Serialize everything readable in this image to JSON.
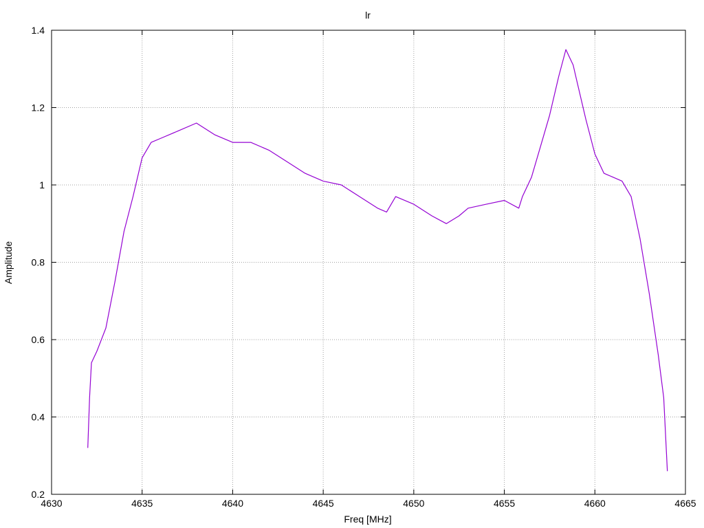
{
  "chart_data": {
    "type": "line",
    "title": "lr",
    "xlabel": "Freq [MHz]",
    "ylabel": "Amplitude",
    "xlim": [
      4630,
      4665
    ],
    "ylim": [
      0.2,
      1.4
    ],
    "grid": true,
    "xticks": [
      4630,
      4635,
      4640,
      4645,
      4650,
      4655,
      4660,
      4665
    ],
    "xtick_labels": [
      "4630",
      "4635",
      "4640",
      "4645",
      "4650",
      "4655",
      "4660",
      "4665"
    ],
    "yticks": [
      0.2,
      0.4,
      0.6,
      0.8,
      1.0,
      1.2,
      1.4
    ],
    "ytick_labels": [
      "0.2",
      "0.4",
      "0.6",
      "0.8",
      "1",
      "1.2",
      "1.4"
    ],
    "line_color": "#9400d3",
    "series": [
      {
        "x": [
          4632.0,
          4632.1,
          4632.2,
          4632.5,
          4633.0,
          4633.5,
          4634.0,
          4634.5,
          4635.0,
          4635.5,
          4636.0,
          4637.0,
          4638.0,
          4639.0,
          4640.0,
          4641.0,
          4642.0,
          4643.0,
          4644.0,
          4645.0,
          4646.0,
          4647.0,
          4648.0,
          4648.5,
          4649.0,
          4650.0,
          4651.0,
          4651.8,
          4652.5,
          4653.0,
          4654.0,
          4655.0,
          4655.8,
          4656.0,
          4656.5,
          4657.0,
          4657.5,
          4658.0,
          4658.4,
          4658.8,
          4659.0,
          4659.5,
          4660.0,
          4660.5,
          4661.0,
          4661.5,
          4662.0,
          4662.5,
          4663.0,
          4663.5,
          4663.8,
          4664.0
        ],
        "y": [
          0.32,
          0.45,
          0.54,
          0.57,
          0.63,
          0.75,
          0.88,
          0.97,
          1.07,
          1.11,
          1.12,
          1.14,
          1.16,
          1.13,
          1.11,
          1.11,
          1.09,
          1.06,
          1.03,
          1.01,
          1.0,
          0.97,
          0.94,
          0.93,
          0.97,
          0.95,
          0.92,
          0.9,
          0.92,
          0.94,
          0.95,
          0.96,
          0.94,
          0.97,
          1.02,
          1.1,
          1.18,
          1.28,
          1.35,
          1.31,
          1.27,
          1.17,
          1.08,
          1.03,
          1.02,
          1.01,
          0.97,
          0.86,
          0.72,
          0.56,
          0.45,
          0.26
        ]
      }
    ]
  }
}
